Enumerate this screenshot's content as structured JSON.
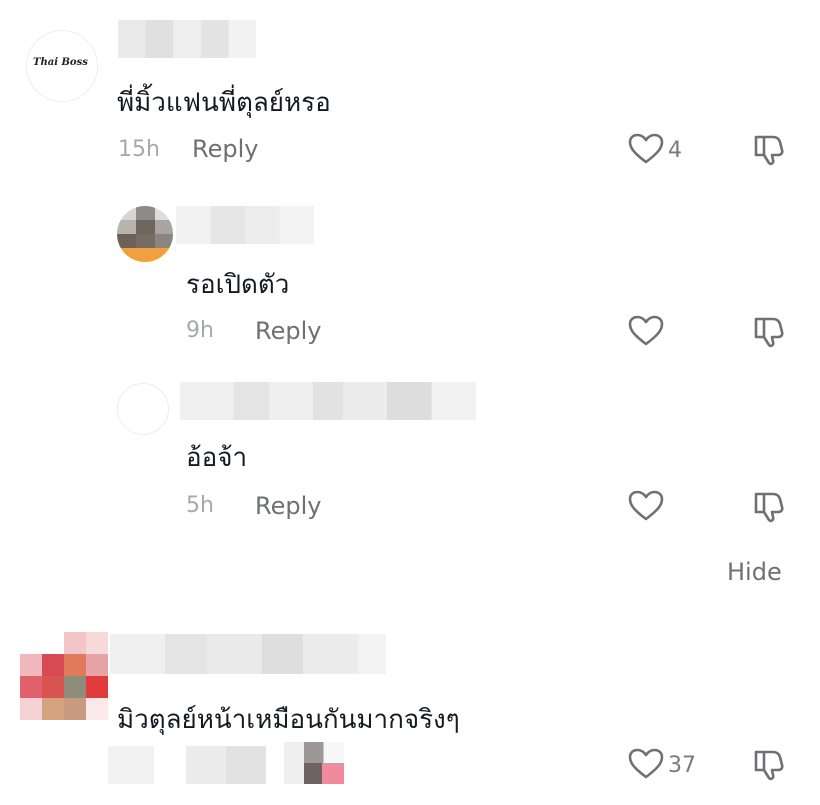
{
  "comments": [
    {
      "avatar_text": "Thai Boss",
      "text": "พี่มิ้วแฟนพี่ตุลย์หรอ",
      "time": "15h",
      "reply": "Reply",
      "likes": "4"
    },
    {
      "text": "รอเปิดตัว",
      "time": "9h",
      "reply": "Reply",
      "likes": ""
    },
    {
      "text": "อ้อจ้า",
      "time": "5h",
      "reply": "Reply",
      "likes": ""
    },
    {
      "text": "มิวตุลย์หน้าเหมือนกันมากจริงๆ",
      "likes": "37"
    }
  ],
  "hide_label": "Hide",
  "icons": {
    "like": "heart-outline-icon",
    "dislike": "thumbs-down-icon"
  }
}
